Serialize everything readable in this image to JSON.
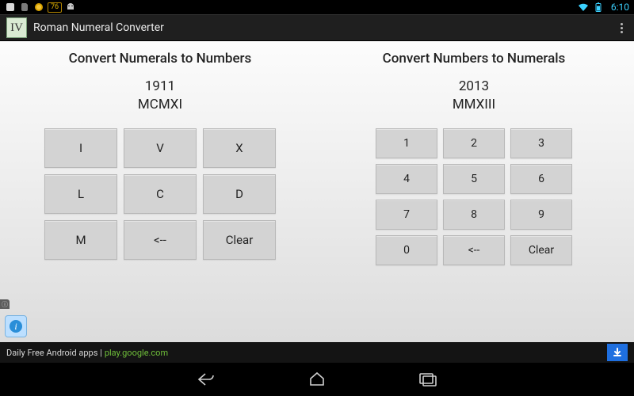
{
  "status": {
    "temp": "76",
    "clock": "6:10"
  },
  "app": {
    "icon_text": "IV",
    "title": "Roman Numeral Converter"
  },
  "left": {
    "heading": "Convert Numerals to Numbers",
    "value_number": "1911",
    "value_roman": "MCMXI",
    "keys": [
      "I",
      "V",
      "X",
      "L",
      "C",
      "D",
      "M",
      "<--",
      "Clear"
    ]
  },
  "right": {
    "heading": "Convert Numbers to Numerals",
    "value_number": "2013",
    "value_roman": "MMXIII",
    "keys": [
      "1",
      "2",
      "3",
      "4",
      "5",
      "6",
      "7",
      "8",
      "9",
      "0",
      "<--",
      "Clear"
    ]
  },
  "ad": {
    "text_prefix": "Daily Free Android apps |",
    "link_text": "play.google.com"
  }
}
